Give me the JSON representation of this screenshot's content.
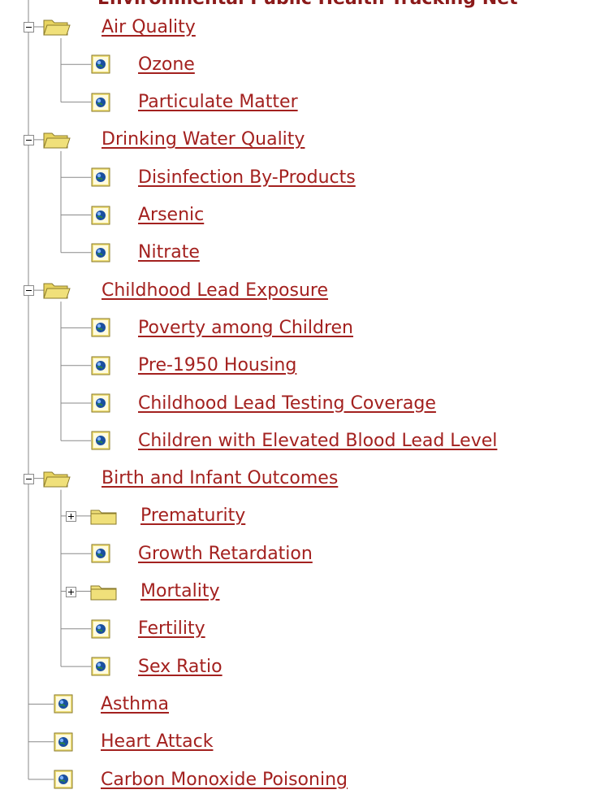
{
  "window": {
    "header_text": "Environmental Public Health Tracking Net"
  },
  "tree": {
    "groups": [
      {
        "label": "Air Quality",
        "expanded": true,
        "children": [
          {
            "label": "Ozone",
            "type": "item"
          },
          {
            "label": "Particulate Matter",
            "type": "item"
          }
        ]
      },
      {
        "label": "Drinking Water Quality",
        "expanded": true,
        "children": [
          {
            "label": "Disinfection By-Products",
            "type": "item"
          },
          {
            "label": "Arsenic",
            "type": "item"
          },
          {
            "label": "Nitrate",
            "type": "item"
          }
        ]
      },
      {
        "label": "Childhood Lead Exposure",
        "expanded": true,
        "children": [
          {
            "label": "Poverty among Children",
            "type": "item"
          },
          {
            "label": "Pre-1950 Housing",
            "type": "item"
          },
          {
            "label": "Childhood Lead Testing Coverage",
            "type": "item"
          },
          {
            "label": "Children with Elevated Blood Lead Level",
            "type": "item"
          }
        ]
      },
      {
        "label": "Birth and Infant Outcomes",
        "expanded": true,
        "children": [
          {
            "label": "Prematurity",
            "type": "folder",
            "expanded": false
          },
          {
            "label": "Growth Retardation",
            "type": "item"
          },
          {
            "label": "Mortality",
            "type": "folder",
            "expanded": false
          },
          {
            "label": "Fertility",
            "type": "item"
          },
          {
            "label": "Sex Ratio",
            "type": "item"
          }
        ]
      }
    ],
    "top_items": [
      {
        "label": "Asthma"
      },
      {
        "label": "Heart Attack"
      },
      {
        "label": "Carbon Monoxide Poisoning"
      }
    ],
    "colors": {
      "link": "#a3211f",
      "folder_fill": "#f0e07a",
      "folder_edge": "#8a7a2a",
      "globe": "#1a4fa0",
      "line": "#8a8a8a"
    }
  }
}
